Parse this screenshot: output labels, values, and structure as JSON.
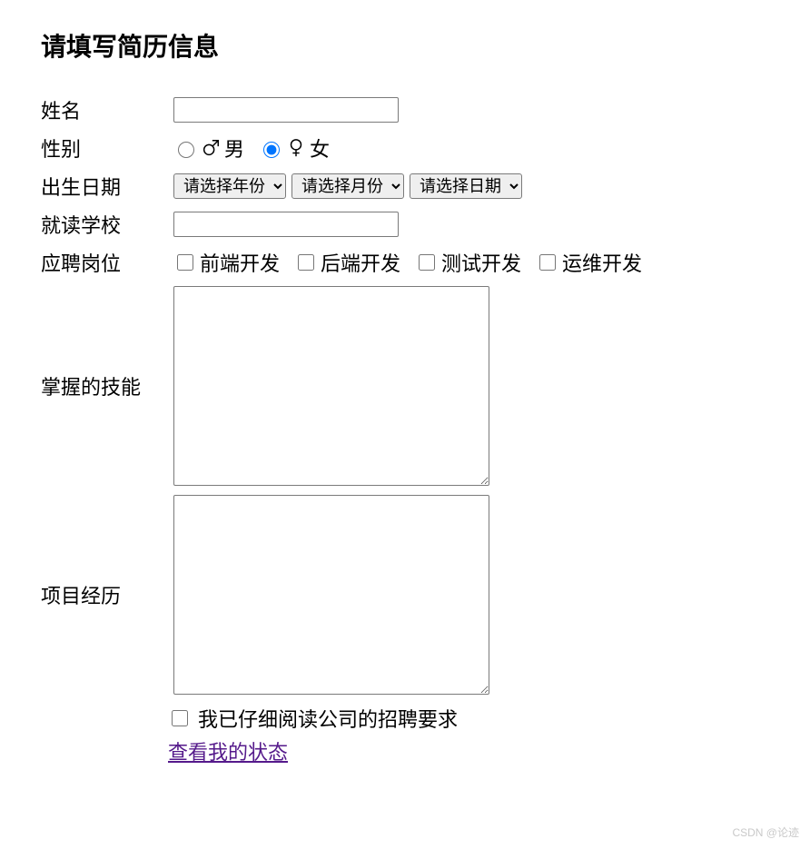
{
  "title": "请填写简历信息",
  "fields": {
    "name": {
      "label": "姓名",
      "value": ""
    },
    "gender": {
      "label": "性别",
      "options": {
        "male": "男",
        "female": "女"
      },
      "selected": "female"
    },
    "birthdate": {
      "label": "出生日期",
      "year_placeholder": "请选择年份",
      "month_placeholder": "请选择月份",
      "day_placeholder": "请选择日期"
    },
    "school": {
      "label": "就读学校",
      "value": ""
    },
    "position": {
      "label": "应聘岗位",
      "options": [
        "前端开发",
        "后端开发",
        "测试开发",
        "运维开发"
      ]
    },
    "skills": {
      "label": "掌握的技能",
      "value": ""
    },
    "projects": {
      "label": "项目经历",
      "value": ""
    },
    "agree": {
      "label": "我已仔细阅读公司的招聘要求",
      "checked": false
    },
    "status_link": "查看我的状态"
  },
  "watermark": "CSDN @论迹"
}
